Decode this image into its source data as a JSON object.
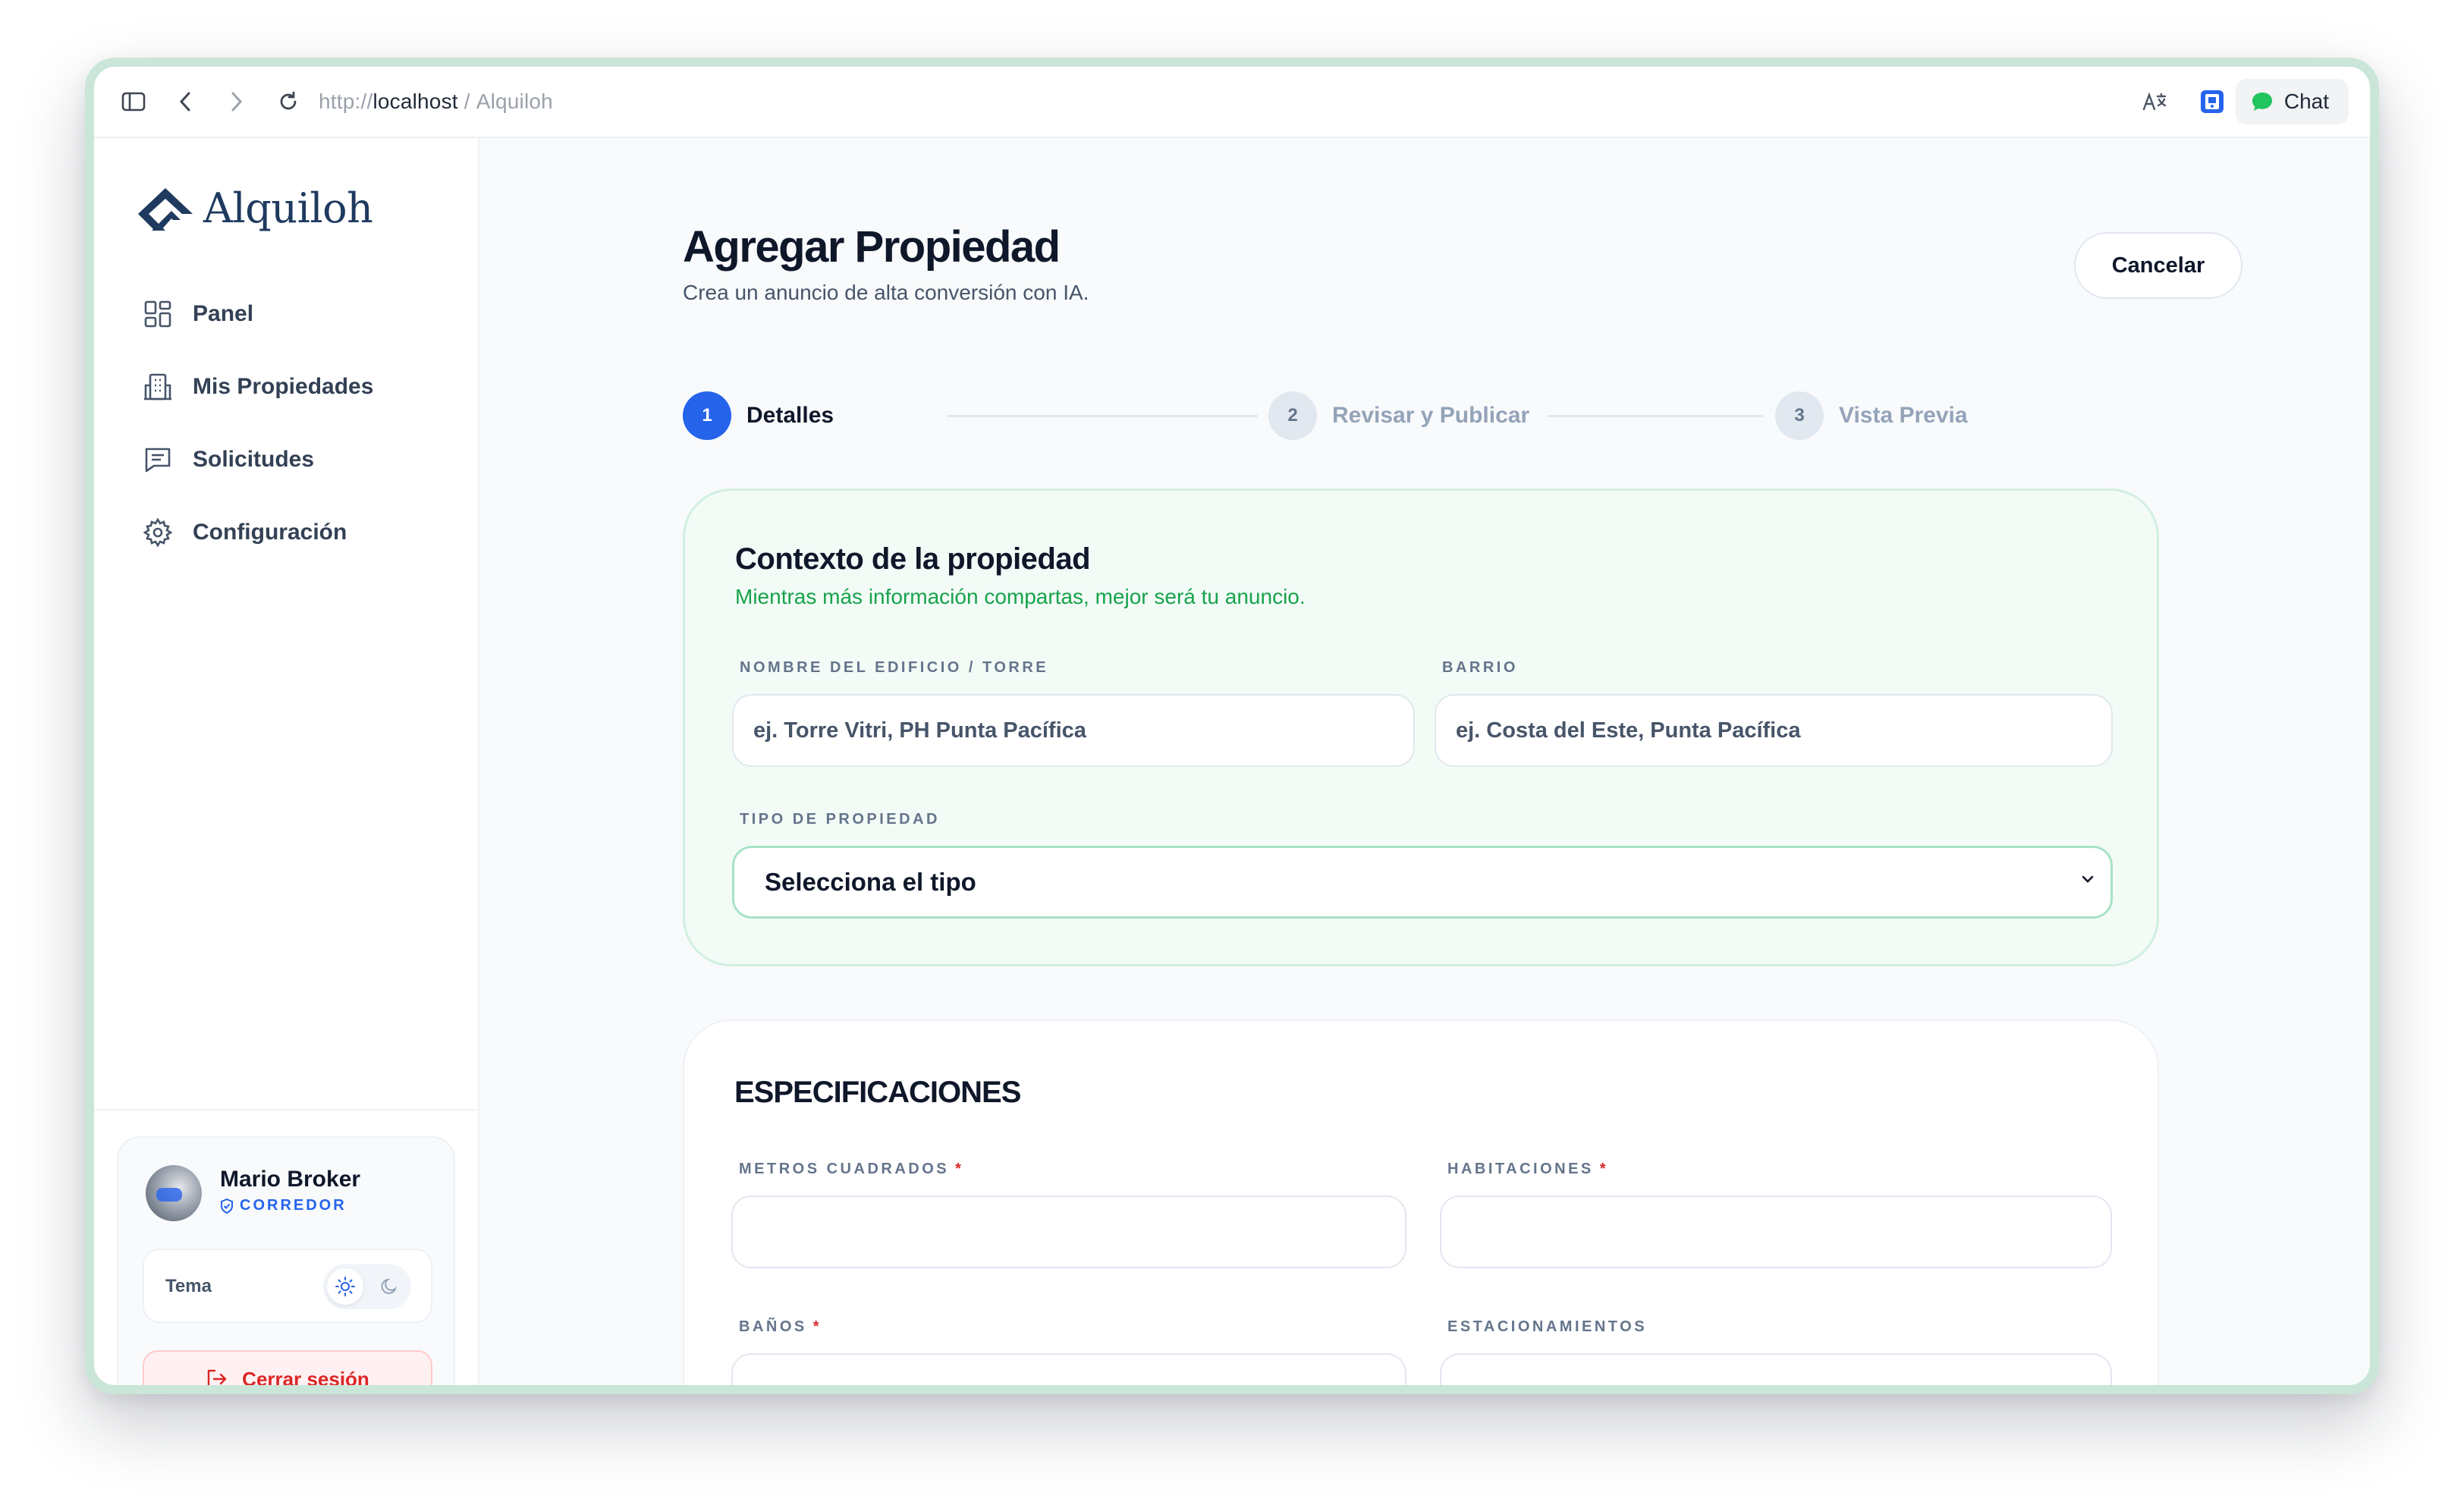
{
  "browser": {
    "url_scheme": "http://",
    "url_host": "localhost",
    "url_sep": " / ",
    "url_title": "Alquiloh",
    "chat_label": "Chat"
  },
  "sidebar": {
    "brand": "Alquiloh",
    "nav": [
      {
        "label": "Panel",
        "icon": "grid-icon"
      },
      {
        "label": "Mis Propiedades",
        "icon": "building-icon"
      },
      {
        "label": "Solicitudes",
        "icon": "message-icon"
      },
      {
        "label": "Configuración",
        "icon": "gear-icon"
      }
    ],
    "user": {
      "name": "Mario Broker",
      "role": "CORREDOR"
    },
    "theme_label": "Tema",
    "logout_label": "Cerrar sesión"
  },
  "main": {
    "title": "Agregar Propiedad",
    "subtitle": "Crea un anuncio de alta conversión con IA.",
    "cancel_label": "Cancelar",
    "steps": [
      {
        "num": "1",
        "label": "Detalles",
        "active": true
      },
      {
        "num": "2",
        "label": "Revisar y Publicar",
        "active": false
      },
      {
        "num": "3",
        "label": "Vista Previa",
        "active": false
      }
    ],
    "context": {
      "title": "Contexto de la propiedad",
      "subtitle": "Mientras más información compartas, mejor será tu anuncio.",
      "building_label": "NOMBRE DEL EDIFICIO / TORRE",
      "building_placeholder": "ej. Torre Vitri, PH Punta Pacífica",
      "barrio_label": "BARRIO",
      "barrio_placeholder": "ej. Costa del Este, Punta Pacífica",
      "type_label": "TIPO DE PROPIEDAD",
      "type_value": "Selecciona el tipo"
    },
    "specs": {
      "title": "ESPECIFICACIONES",
      "required_mark": "*",
      "m2_label": "METROS CUADRADOS",
      "rooms_label": "HABITACIONES",
      "baths_label": "BAÑOS",
      "parking_label": "ESTACIONAMIENTOS"
    }
  },
  "colors": {
    "accent": "#2563eb",
    "success": "#16a34a",
    "danger": "#dc2626"
  }
}
